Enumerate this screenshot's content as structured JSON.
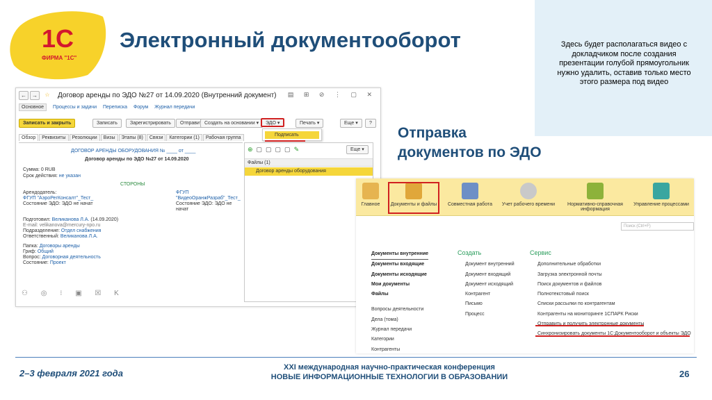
{
  "slide": {
    "title": "Электронный документооборот",
    "logo_text": "1С",
    "logo_firm": "ФИРМА \"1С\"",
    "video_note": "Здесь будет располагаться видео с докладчиком после создания презентации голубой прямоугольник нужно удалить, оставив только место этого размера под видео",
    "send_title_1": "Отправка",
    "send_title_2": "документов по ЭДО"
  },
  "doc_window": {
    "title": "Договор аренды по ЭДО №27 от 14.09.2020 (Внутренний документ)",
    "nav_tabs": [
      "Основное",
      "Процессы и задачи",
      "Переписка",
      "Форум",
      "Журнал передачи"
    ],
    "buttons": {
      "save_close": "Записать и закрыть",
      "save": "Записать",
      "register": "Зарегистрировать",
      "send": "Отправить...",
      "create_based": "Создать на основании ▾",
      "edo": "ЭДО ▾",
      "print": "Печать ▾",
      "more": "Еще ▾",
      "help": "?"
    },
    "dropdown_item": "Подписать",
    "subtabs": [
      "Обзор",
      "Реквизиты",
      "Резолюции",
      "Визы",
      "Этапы (8)",
      "Связи",
      "Категории (1)",
      "Рабочая группа"
    ],
    "form": {
      "doc_heading": "ДОГОВОР АРЕНДЫ ОБОРУДОВАНИЯ № ____ от ____",
      "doc_sub": "Договор аренды по ЭДО №27 от 14.09.2020",
      "sum": "Сумма: 0 RUB",
      "term_label": "Срок действия: ",
      "term_value": "не указан",
      "parties": "СТОРОНЫ",
      "left_role": "Арендодатель:",
      "left_org": "ФГУП \"АэроРегКонсалт\"_Тест_",
      "left_state": "Состояние ЭДО: ЭДО не начат",
      "right_role": "ФГУП",
      "right_org": "\"ВидеоОранжРазраб\"_Тест_",
      "right_state": "Состояние ЭДО: ЭДО не",
      "right_state2": "начат",
      "prepared": "Подготовил: ",
      "prepared_name": "Великанова Л.А.",
      "prepared_date": " (14.09.2020)",
      "email": "E-mail: velikanova@mercury-npo.ru",
      "dept_label": "Подразделение: ",
      "dept_value": "Отдел снабжения",
      "resp_label": "Ответственный: ",
      "resp_value": "Великанова Л.А.",
      "folder_label": "Папка: ",
      "folder_value": "Договоры аренды",
      "grif_label": "Гриф: ",
      "grif_value": "Общий",
      "question_label": "Вопрос: ",
      "question_value": "Договорная деятельность",
      "status_label": "Состояние: ",
      "status_value": "Проект"
    },
    "files": {
      "more": "Еще ▾",
      "header": "Файлы (1)",
      "file": "Договор аренды оборудования"
    }
  },
  "main_window": {
    "sections": [
      "Главное",
      "Документы и файлы",
      "Совместная работа",
      "Учет рабочего времени",
      "Нормативно-справочная информация",
      "Управление процессами"
    ],
    "search_placeholder": "Поиск (Ctrl+F)",
    "nav": [
      "Документы внутренние",
      "Документы входящие",
      "Документы исходящие",
      "Мои документы",
      "Файлы",
      "Вопросы деятельности",
      "Дела (тома)",
      "Журнал передачи",
      "Категории",
      "Контрагенты"
    ],
    "create_header": "Создать",
    "create": [
      "Документ внутренний",
      "Документ входящий",
      "Документ исходящий",
      "Контрагент",
      "Письмо",
      "Процесс"
    ],
    "service_header": "Сервис",
    "service": [
      "Дополнительные обработки",
      "Загрузка электронной почты",
      "Поиск документов и файлов",
      "Полнотекстовый поиск",
      "Списки рассылки по контрагентам",
      "Контрагенты на мониторинге 1СПАРК Риски",
      "Отправить и получить электронные документы",
      "Синхронизировать документы 1С:Документооборот и объекты ЭДО"
    ]
  },
  "footer": {
    "date": "2–3 февраля 2021 года",
    "conf_line1": "XXI международная научно-практическая конференция",
    "conf_line2": "НОВЫЕ ИНФОРМАЦИОННЫЕ ТЕХНОЛОГИИ В ОБРАЗОВАНИИ",
    "page": "26"
  }
}
